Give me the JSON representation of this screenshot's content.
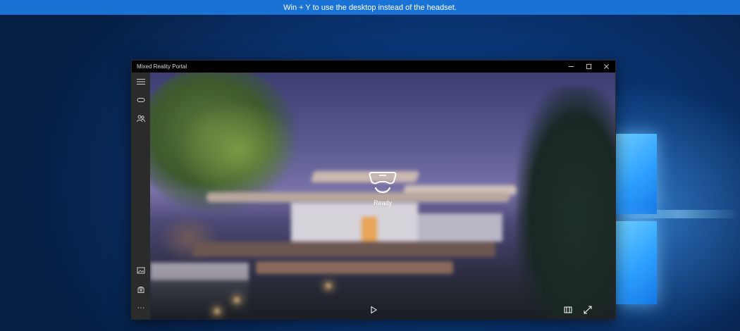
{
  "banner": {
    "text": "Win + Y to use the desktop instead of the headset."
  },
  "window": {
    "title": "Mixed Reality Portal",
    "controls": {
      "minimize_icon": "minimize-icon",
      "maximize_icon": "maximize-icon",
      "close_icon": "close-icon"
    }
  },
  "sidebar": {
    "top_items": [
      {
        "icon": "hamburger-menu-icon"
      },
      {
        "icon": "headset-icon"
      },
      {
        "icon": "people-icon"
      }
    ],
    "bottom_items": [
      {
        "icon": "image-icon"
      },
      {
        "icon": "store-icon"
      },
      {
        "icon": "more-icon",
        "label": "···"
      }
    ]
  },
  "status": {
    "icon": "headset-ready-icon",
    "label": "Ready"
  },
  "controls": {
    "play_icon": "play-icon",
    "panel_icon": "split-view-icon",
    "expand_icon": "expand-icon"
  },
  "colors": {
    "banner": "#1a72d4",
    "titlebar": "#000000",
    "sidebar": "#2b2b2b",
    "wallpaper": "#0a3778"
  }
}
